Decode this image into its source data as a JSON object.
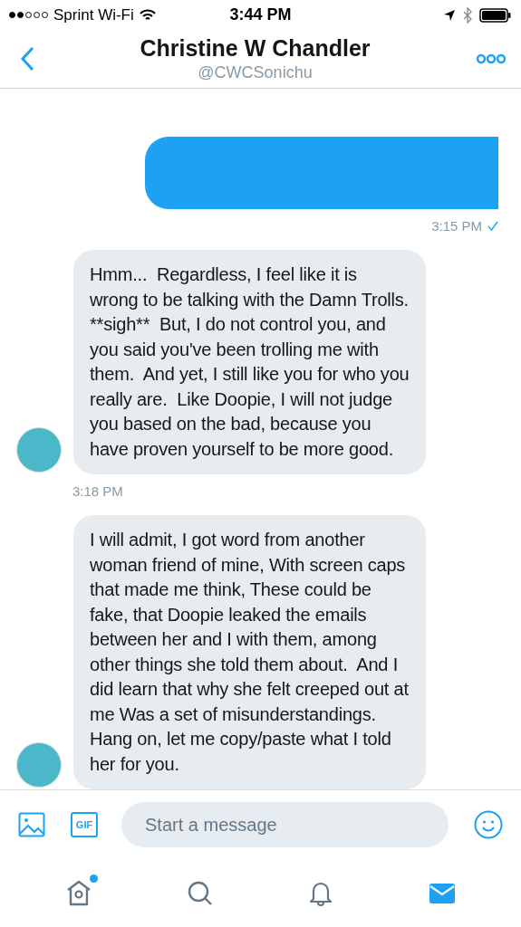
{
  "status_bar": {
    "carrier": "Sprint Wi-Fi",
    "time": "3:44 PM"
  },
  "header": {
    "title": "Christine W Chandler",
    "handle": "@CWCSonichu"
  },
  "messages": [
    {
      "kind": "outgoing",
      "time": "3:15 PM",
      "read": true
    },
    {
      "kind": "incoming",
      "text": "Hmm...  Regardless, I feel like it is wrong to be talking with the Damn Trolls.  **sigh**  But, I do not control you, and you said you've been trolling me with them.  And yet, I still like you for who you really are.  Like Doopie, I will not judge you based on the bad, because you have proven yourself to be more good.",
      "time": "3:18 PM"
    },
    {
      "kind": "incoming",
      "text": "I will admit, I got word from another woman friend of mine, With screen caps that made me think, These could be fake, that Doopie leaked the emails between her and I with them, among other things she told them about.  And I did learn that why she felt creeped out at me Was a set of misunderstandings.  Hang on, let me copy/paste what I told her for you."
    }
  ],
  "composer": {
    "gif_label": "GIF",
    "placeholder": "Start a message"
  },
  "tabs": [
    {
      "kind": "home",
      "selected": false,
      "badge": true
    },
    {
      "kind": "search",
      "selected": false,
      "badge": false
    },
    {
      "kind": "notifications",
      "selected": false,
      "badge": false
    },
    {
      "kind": "messages",
      "selected": true,
      "badge": false
    }
  ]
}
